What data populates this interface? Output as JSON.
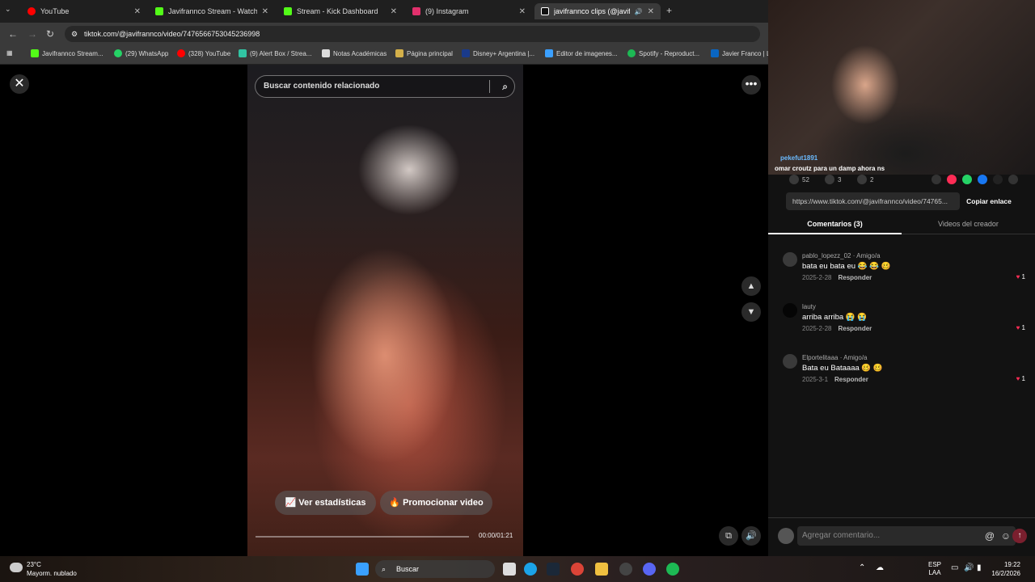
{
  "browser": {
    "tabs": [
      {
        "label": "YouTube",
        "color": "#ff0000"
      },
      {
        "label": "Javifrannco Stream - Watch Live",
        "color": "#53fc18"
      },
      {
        "label": "Stream - Kick Dashboard",
        "color": "#53fc18"
      },
      {
        "label": "(9) Instagram",
        "color": "#e1306c"
      },
      {
        "label": "javifrannco clips (@javifrannco)",
        "color": "#ffffff"
      }
    ],
    "new_tab": "+",
    "url": "tiktok.com/@javifrannco/video/7476566753045236998",
    "bookmarks": [
      {
        "label": "Javifrannco Stream...",
        "color": "#53fc18"
      },
      {
        "label": "(29) WhatsApp",
        "color": "#25d366"
      },
      {
        "label": "(328) YouTube",
        "color": "#ff0000"
      },
      {
        "label": "(9) Alert Box / Strea...",
        "color": "#31c3a2"
      },
      {
        "label": "Notas Académicas",
        "color": "#dddddd"
      },
      {
        "label": "Página principal",
        "color": "#d4b04a"
      },
      {
        "label": "Disney+ Argentina |...",
        "color": "#1a3a8a"
      },
      {
        "label": "Editor de imagenes...",
        "color": "#3ba0ff"
      },
      {
        "label": "Spotify - Reproduct...",
        "color": "#1db954"
      },
      {
        "label": "Javier Franco | Li",
        "color": "#0a66c2"
      }
    ]
  },
  "viewer": {
    "close_icon": "✕",
    "more_icon": "•••",
    "search_placeholder": "Buscar contenido relacionado",
    "stats_button": "Ver estadísticas",
    "promote_button": "Promocionar video",
    "time": "00:00/01:21",
    "progress": 0.0
  },
  "webcam": {
    "chat_user": "pekefut1891",
    "chat_message": "omar croutz para un damp ahora ns"
  },
  "panel": {
    "likes": "52",
    "comments_count": "3",
    "saves": "2",
    "link": "https://www.tiktok.com/@javifrannco/video/74765...",
    "copy_link": "Copiar enlace",
    "tab_comments": "Comentarios (3)",
    "tab_videos": "Videos del creador",
    "comments": [
      {
        "user": "pablo_lopezz_02 · Amigo/a",
        "text": "bata eu bata eu 😂 😂 🥴",
        "date": "2025-2-28",
        "reply": "Responder",
        "likes": "1"
      },
      {
        "user": "lauty",
        "text": "arriba arriba 😭 😭",
        "date": "2025-2-28",
        "reply": "Responder",
        "likes": "1"
      },
      {
        "user": "Elportelitaaa · Amigo/a",
        "text": "Bata eu Bataaaa 🥴 🥴",
        "date": "2025-3-1",
        "reply": "Responder",
        "likes": "1"
      }
    ],
    "comment_placeholder": "Agregar comentario..."
  },
  "taskbar": {
    "weather_temp": "23°C",
    "weather_desc": "Mayorm. nublado",
    "search_label": "Buscar",
    "lang": "ESP",
    "lang2": "LAA",
    "time": "19:22",
    "date": "16/2/2026"
  }
}
